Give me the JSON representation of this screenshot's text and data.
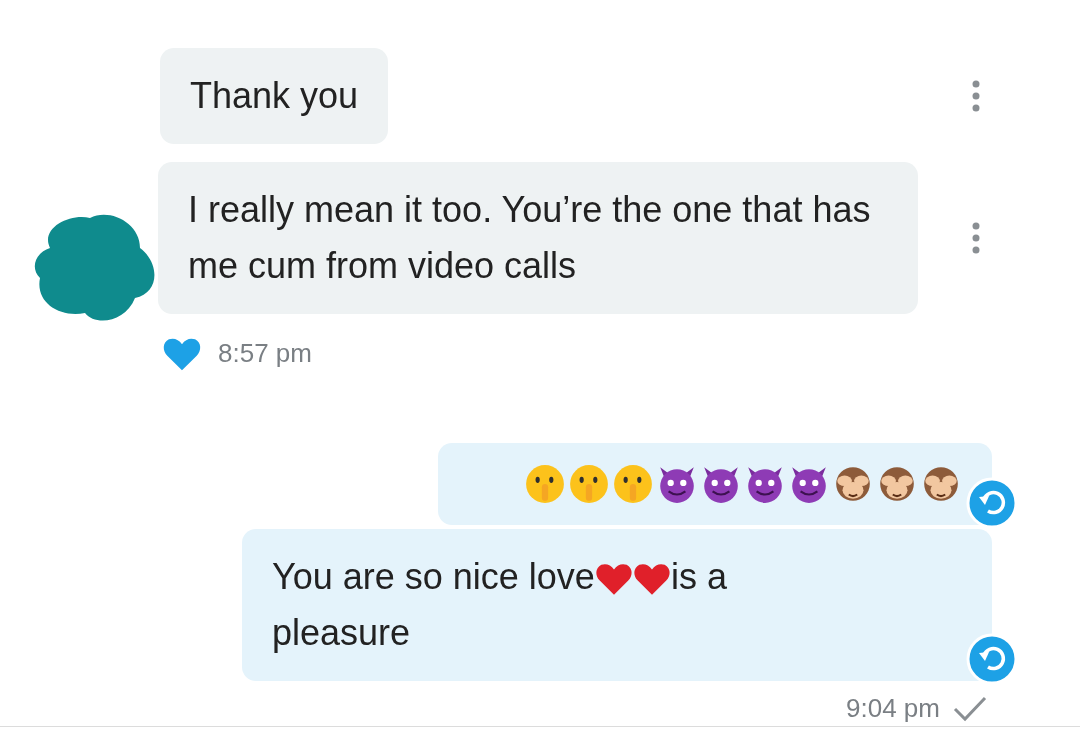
{
  "messages": [
    {
      "kind": "received",
      "parts": [
        {
          "kind": "text",
          "text": "Thank you"
        }
      ],
      "menu": true,
      "avatar": false
    },
    {
      "kind": "received",
      "parts": [
        {
          "kind": "text",
          "text": "I really mean it too. You’re the one that has me cum from video calls"
        }
      ],
      "menu": true,
      "avatar": true,
      "liked": true,
      "time": "8:57 pm"
    },
    {
      "kind": "sent",
      "parts": [
        {
          "kind": "shush"
        },
        {
          "kind": "shush"
        },
        {
          "kind": "shush"
        },
        {
          "kind": "devil"
        },
        {
          "kind": "devil"
        },
        {
          "kind": "devil"
        },
        {
          "kind": "devil"
        },
        {
          "kind": "monkey"
        },
        {
          "kind": "monkey"
        },
        {
          "kind": "monkey"
        }
      ],
      "reply": true
    },
    {
      "kind": "sent",
      "parts": [
        {
          "kind": "text",
          "text": "You are so nice love"
        },
        {
          "kind": "heart"
        },
        {
          "kind": "heart"
        },
        {
          "kind": "text",
          "text": "is a pleasure"
        }
      ],
      "reply": true,
      "time": "9:04 pm",
      "read": true
    }
  ]
}
